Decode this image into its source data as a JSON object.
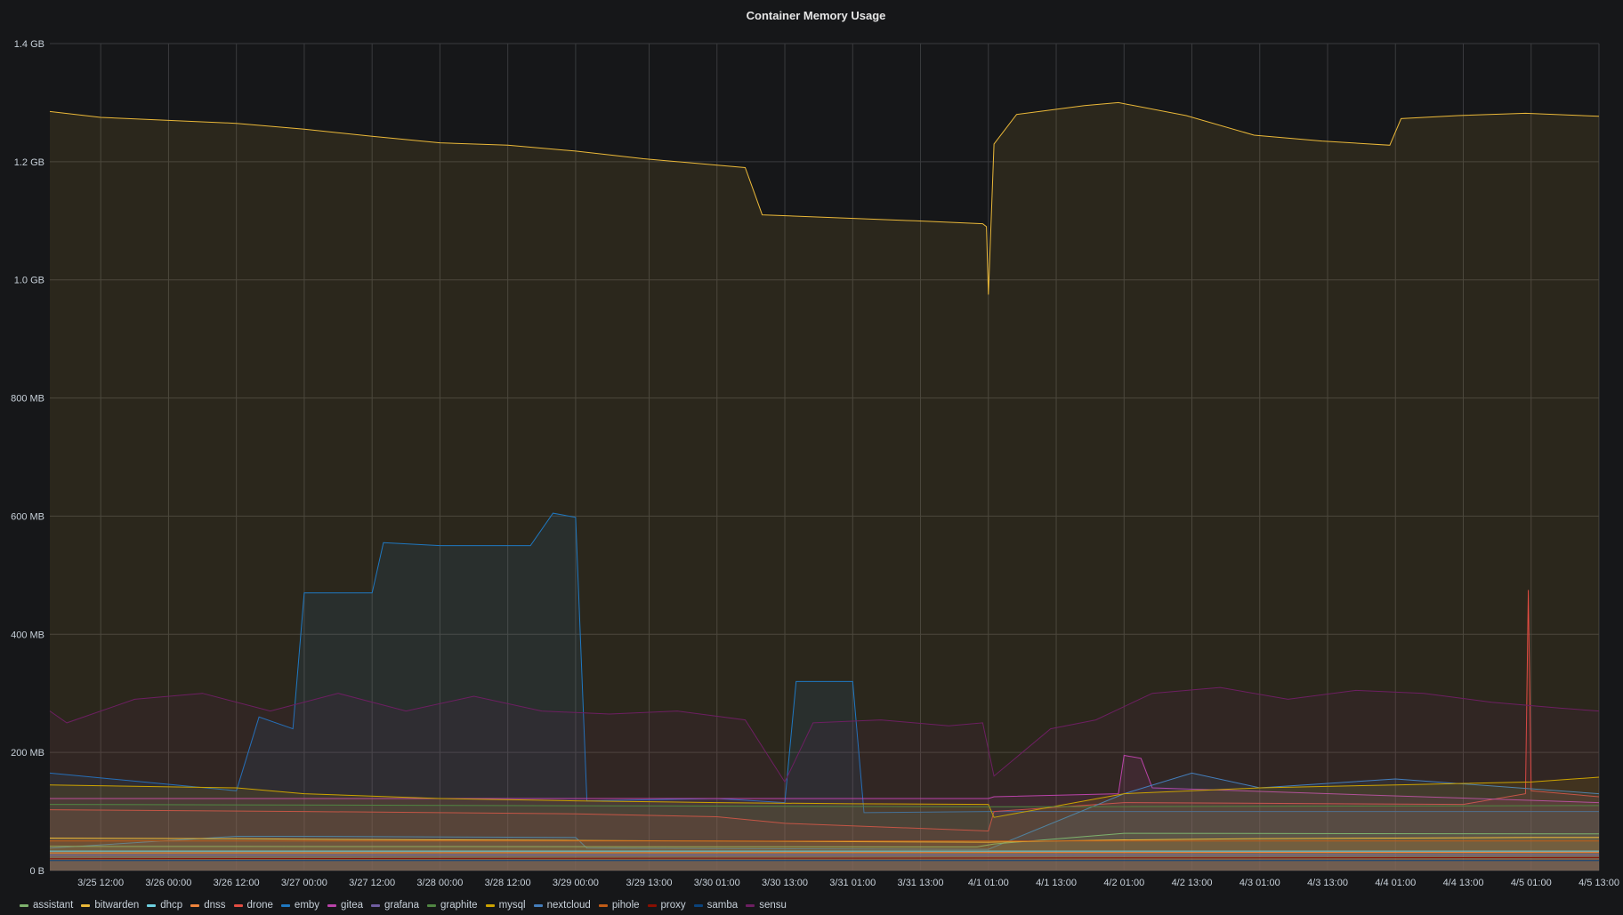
{
  "chart_data": {
    "type": "area",
    "title": "Container Memory Usage",
    "y_unit": "bytes",
    "ylim": [
      0,
      1400000000
    ],
    "ytick_labels": [
      "0 B",
      "200 MB",
      "400 MB",
      "600 MB",
      "800 MB",
      "1.0 GB",
      "1.2 GB",
      "1.4 GB"
    ],
    "ytick_values": [
      0,
      200000000,
      400000000,
      600000000,
      800000000,
      1000000000,
      1200000000,
      1400000000
    ],
    "xlim": [
      "2020-03-25 03:00",
      "2020-04-05 13:00"
    ],
    "xtick_labels": [
      "3/25 12:00",
      "3/26 00:00",
      "3/26 12:00",
      "3/27 00:00",
      "3/27 12:00",
      "3/28 00:00",
      "3/28 12:00",
      "3/29 00:00",
      "3/29 13:00",
      "3/30 01:00",
      "3/30 13:00",
      "3/31 01:00",
      "3/31 13:00",
      "4/1 01:00",
      "4/1 13:00",
      "4/2 01:00",
      "4/2 13:00",
      "4/3 01:00",
      "4/3 13:00",
      "4/4 01:00",
      "4/4 13:00",
      "4/5 01:00",
      "4/5 13:00"
    ],
    "xtick_times": [
      "2020-03-25 12:00",
      "2020-03-26 00:00",
      "2020-03-26 12:00",
      "2020-03-27 00:00",
      "2020-03-27 12:00",
      "2020-03-28 00:00",
      "2020-03-28 12:00",
      "2020-03-29 00:00",
      "2020-03-29 13:00",
      "2020-03-30 01:00",
      "2020-03-30 13:00",
      "2020-03-31 01:00",
      "2020-03-31 13:00",
      "2020-04-01 01:00",
      "2020-04-01 13:00",
      "2020-04-02 01:00",
      "2020-04-02 13:00",
      "2020-04-03 01:00",
      "2020-04-03 13:00",
      "2020-04-04 01:00",
      "2020-04-04 13:00",
      "2020-04-05 01:00",
      "2020-04-05 13:00"
    ],
    "grid": true,
    "legend_position": "bottom-left",
    "series": [
      {
        "name": "assistant",
        "color": "#7eb26d",
        "x": [
          "2020-03-25 03:00",
          "2020-03-31 23:00",
          "2020-04-01 02:00",
          "2020-04-02 01:00",
          "2020-04-05 13:00"
        ],
        "values": [
          41000000,
          40000000,
          45000000,
          63000000,
          62000000
        ]
      },
      {
        "name": "bitwarden",
        "color": "#eab839",
        "x": [
          "2020-03-25 03:00",
          "2020-03-26 12:00",
          "2020-03-27 00:00",
          "2020-03-28 00:00",
          "2020-03-29 00:00",
          "2020-03-30 01:00",
          "2020-03-31 01:00",
          "2020-04-01 01:00",
          "2020-04-02 01:00",
          "2020-04-03 01:00",
          "2020-04-04 01:00",
          "2020-04-05 01:00",
          "2020-04-05 13:00"
        ],
        "values": [
          55000000,
          54000000,
          53000000,
          52000000,
          51000000,
          50000000,
          49000000,
          48000000,
          52000000,
          54000000,
          55000000,
          56000000,
          56000000
        ]
      },
      {
        "name": "dhcp",
        "color": "#6ed0e0",
        "x": [
          "2020-03-25 03:00",
          "2020-04-05 13:00"
        ],
        "values": [
          33000000,
          33000000
        ]
      },
      {
        "name": "dnss",
        "color": "#ef843c",
        "x": [
          "2020-03-25 03:00",
          "2020-04-05 13:00"
        ],
        "values": [
          30000000,
          31000000
        ]
      },
      {
        "name": "drone",
        "color": "#e24d42",
        "x": [
          "2020-03-25 03:00",
          "2020-03-27 00:00",
          "2020-03-29 00:00",
          "2020-03-30 01:00",
          "2020-03-30 13:00",
          "2020-04-01 01:00",
          "2020-04-01 02:00",
          "2020-04-02 01:00",
          "2020-04-04 13:00",
          "2020-04-05 00:00",
          "2020-04-05 00:30",
          "2020-04-05 01:00",
          "2020-04-05 13:00"
        ],
        "values": [
          103000000,
          100000000,
          96000000,
          91000000,
          80000000,
          67000000,
          100000000,
          115000000,
          112000000,
          130000000,
          475000000,
          135000000,
          125000000
        ]
      },
      {
        "name": "emby",
        "color": "#1f78c1",
        "x": [
          "2020-03-25 03:00",
          "2020-03-26 12:00",
          "2020-03-26 16:00",
          "2020-03-26 22:00",
          "2020-03-27 00:00",
          "2020-03-27 12:00",
          "2020-03-27 14:00",
          "2020-03-28 00:00",
          "2020-03-28 16:00",
          "2020-03-28 20:00",
          "2020-03-29 00:00",
          "2020-03-29 02:00",
          "2020-03-30 01:00",
          "2020-03-30 13:00",
          "2020-03-30 15:00",
          "2020-03-31 01:00",
          "2020-03-31 03:00",
          "2020-04-01 01:00",
          "2020-04-05 13:00"
        ],
        "values": [
          165000000,
          135000000,
          260000000,
          240000000,
          470000000,
          470000000,
          555000000,
          550000000,
          550000000,
          605000000,
          598000000,
          118000000,
          122000000,
          115000000,
          320000000,
          320000000,
          98000000,
          100000000,
          100000000
        ]
      },
      {
        "name": "gitea",
        "color": "#ba43a9",
        "x": [
          "2020-03-25 03:00",
          "2020-04-01 01:00",
          "2020-04-01 02:00",
          "2020-04-02 00:00",
          "2020-04-02 01:00",
          "2020-04-02 04:00",
          "2020-04-02 06:00",
          "2020-04-05 13:00"
        ],
        "values": [
          122000000,
          122000000,
          125000000,
          130000000,
          195000000,
          190000000,
          140000000,
          115000000
        ]
      },
      {
        "name": "grafana",
        "color": "#705da0",
        "x": [
          "2020-03-25 03:00",
          "2020-04-05 13:00"
        ],
        "values": [
          26000000,
          27000000
        ]
      },
      {
        "name": "graphite",
        "color": "#508642",
        "x": [
          "2020-03-25 03:00",
          "2020-04-01 01:00",
          "2020-04-01 02:00",
          "2020-04-05 13:00"
        ],
        "values": [
          112000000,
          108000000,
          108000000,
          110000000
        ]
      },
      {
        "name": "mysql",
        "color": "#cca300",
        "x": [
          "2020-03-25 03:00",
          "2020-03-26 12:00",
          "2020-03-27 00:00",
          "2020-03-28 00:00",
          "2020-03-29 00:00",
          "2020-03-30 01:00",
          "2020-03-31 01:00",
          "2020-04-01 01:00",
          "2020-04-01 02:00",
          "2020-04-02 01:00",
          "2020-04-03 01:00",
          "2020-04-04 01:00",
          "2020-04-05 01:00",
          "2020-04-05 13:00"
        ],
        "values": [
          145000000,
          140000000,
          130000000,
          122000000,
          118000000,
          115000000,
          113000000,
          112000000,
          90000000,
          130000000,
          140000000,
          145000000,
          150000000,
          158000000
        ]
      },
      {
        "name": "nextcloud",
        "color": "#447ebc",
        "x": [
          "2020-03-25 03:00",
          "2020-03-26 12:00",
          "2020-03-27 00:00",
          "2020-03-29 00:00",
          "2020-03-29 02:00",
          "2020-04-01 01:00",
          "2020-04-02 01:00",
          "2020-04-02 13:00",
          "2020-04-03 01:00",
          "2020-04-04 01:00",
          "2020-04-05 13:00"
        ],
        "values": [
          38000000,
          58000000,
          58000000,
          56000000,
          38000000,
          36000000,
          130000000,
          165000000,
          140000000,
          155000000,
          130000000
        ]
      },
      {
        "name": "pihole",
        "color": "#c15c17",
        "x": [
          "2020-03-25 03:00",
          "2020-04-05 13:00"
        ],
        "values": [
          50000000,
          50000000
        ]
      },
      {
        "name": "proxy",
        "color": "#890f02",
        "x": [
          "2020-03-25 03:00",
          "2020-04-05 13:00"
        ],
        "values": [
          20000000,
          22000000
        ]
      },
      {
        "name": "samba",
        "color": "#0a437c",
        "x": [
          "2020-03-25 03:00",
          "2020-04-05 13:00"
        ],
        "values": [
          17000000,
          17000000
        ]
      },
      {
        "name": "sensu",
        "color": "#6d1f62",
        "x": [
          "2020-03-25 03:00",
          "2020-03-25 06:00",
          "2020-03-25 18:00",
          "2020-03-26 06:00",
          "2020-03-26 18:00",
          "2020-03-27 06:00",
          "2020-03-27 18:00",
          "2020-03-28 06:00",
          "2020-03-28 18:00",
          "2020-03-29 06:00",
          "2020-03-29 18:00",
          "2020-03-30 06:00",
          "2020-03-30 13:00",
          "2020-03-30 18:00",
          "2020-03-31 06:00",
          "2020-03-31 18:00",
          "2020-04-01 00:00",
          "2020-04-01 02:00",
          "2020-04-01 12:00",
          "2020-04-01 20:00",
          "2020-04-02 06:00",
          "2020-04-02 18:00",
          "2020-04-03 06:00",
          "2020-04-03 18:00",
          "2020-04-04 06:00",
          "2020-04-04 18:00",
          "2020-04-05 06:00",
          "2020-04-05 13:00"
        ],
        "values": [
          270000000,
          250000000,
          290000000,
          300000000,
          270000000,
          300000000,
          270000000,
          295000000,
          270000000,
          265000000,
          270000000,
          255000000,
          150000000,
          250000000,
          255000000,
          245000000,
          250000000,
          160000000,
          240000000,
          255000000,
          300000000,
          310000000,
          290000000,
          305000000,
          300000000,
          285000000,
          275000000,
          270000000
        ]
      },
      {
        "name": "",
        "color": "#eab839",
        "x": [
          "2020-03-25 03:00",
          "2020-03-25 12:00",
          "2020-03-26 12:00",
          "2020-03-27 00:00",
          "2020-03-27 12:00",
          "2020-03-28 00:00",
          "2020-03-28 12:00",
          "2020-03-29 00:00",
          "2020-03-29 12:00",
          "2020-03-30 06:00",
          "2020-03-30 07:30",
          "2020-03-30 09:00",
          "2020-03-31 12:00",
          "2020-04-01 00:00",
          "2020-04-01 00:40",
          "2020-04-01 01:00",
          "2020-04-01 02:00",
          "2020-04-01 06:00",
          "2020-04-01 18:00",
          "2020-04-02 00:00",
          "2020-04-02 12:00",
          "2020-04-03 00:00",
          "2020-04-03 12:00",
          "2020-04-04 00:00",
          "2020-04-04 02:00",
          "2020-04-04 12:00",
          "2020-04-05 00:00",
          "2020-04-05 13:00"
        ],
        "values": [
          1285000000,
          1275000000,
          1265000000,
          1255000000,
          1243000000,
          1232000000,
          1228000000,
          1218000000,
          1205000000,
          1190000000,
          1150000000,
          1110000000,
          1100000000,
          1095000000,
          1090000000,
          975000000,
          1230000000,
          1280000000,
          1295000000,
          1300000000,
          1278000000,
          1245000000,
          1235000000,
          1228000000,
          1273000000,
          1278000000,
          1282000000,
          1277000000
        ]
      }
    ]
  }
}
